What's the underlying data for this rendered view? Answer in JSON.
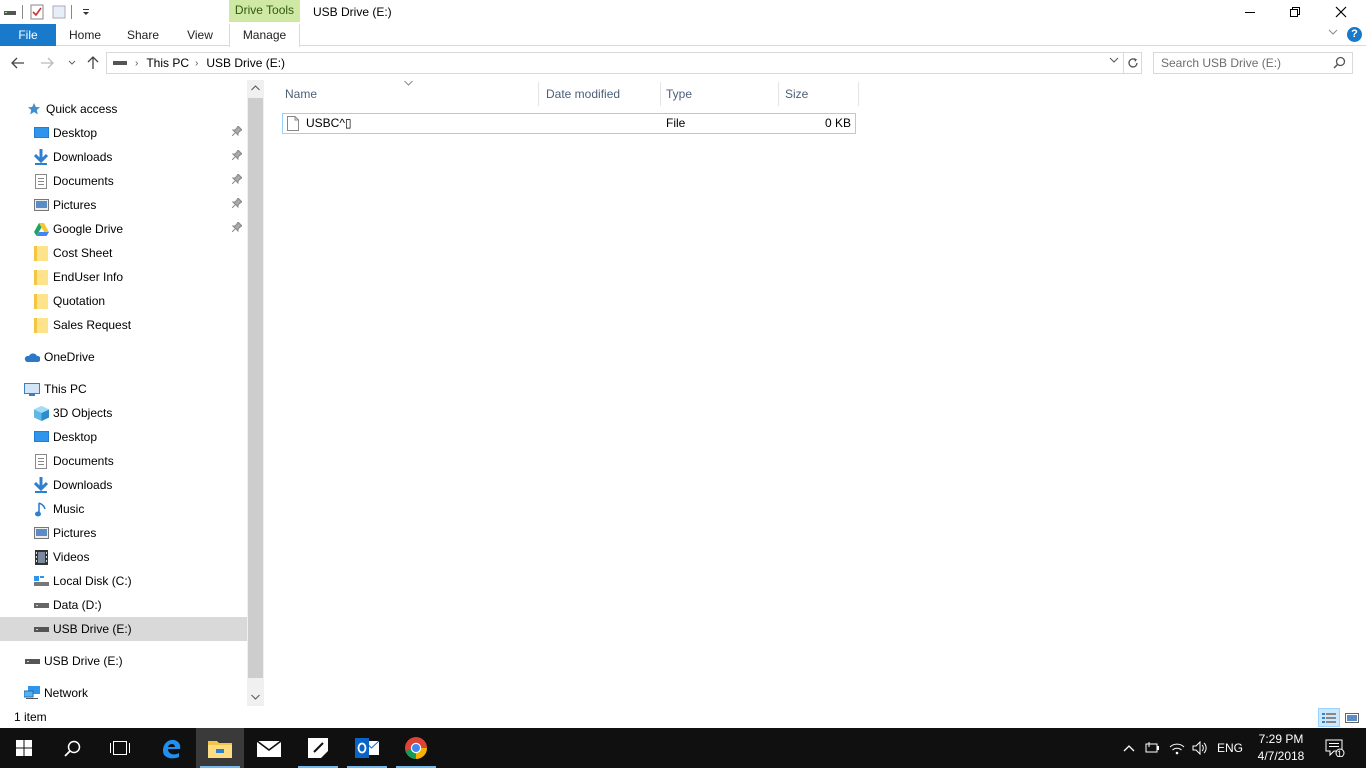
{
  "window": {
    "title": "USB Drive (E:)",
    "context_tab_group": "Drive Tools",
    "controls": {
      "minimize": "—",
      "maximize": "❐",
      "close": "✕"
    }
  },
  "ribbon": {
    "tabs": [
      "File",
      "Home",
      "Share",
      "View",
      "Manage"
    ],
    "file_color": "#1979CA",
    "context_color": "#CFE8A4",
    "help": "?"
  },
  "address": {
    "breadcrumb": [
      "This PC",
      "USB Drive (E:)"
    ],
    "search_placeholder": "Search USB Drive (E:)"
  },
  "nav_pane": {
    "quick_access": {
      "label": "Quick access",
      "items": [
        {
          "label": "Desktop",
          "icon": "desktop-icon",
          "pinned": true
        },
        {
          "label": "Downloads",
          "icon": "downloads-icon",
          "pinned": true
        },
        {
          "label": "Documents",
          "icon": "documents-icon",
          "pinned": true
        },
        {
          "label": "Pictures",
          "icon": "pictures-icon",
          "pinned": true
        },
        {
          "label": "Google Drive",
          "icon": "google-drive-icon",
          "pinned": true
        },
        {
          "label": "Cost Sheet",
          "icon": "folder-icon",
          "pinned": false
        },
        {
          "label": "EndUser Info",
          "icon": "folder-icon",
          "pinned": false
        },
        {
          "label": "Quotation",
          "icon": "folder-icon",
          "pinned": false
        },
        {
          "label": "Sales Request",
          "icon": "folder-icon",
          "pinned": false
        }
      ]
    },
    "onedrive": "OneDrive",
    "this_pc": {
      "label": "This PC",
      "items": [
        {
          "label": "3D Objects",
          "icon": "3d-objects-icon"
        },
        {
          "label": "Desktop",
          "icon": "desktop-icon"
        },
        {
          "label": "Documents",
          "icon": "documents-icon"
        },
        {
          "label": "Downloads",
          "icon": "downloads-icon"
        },
        {
          "label": "Music",
          "icon": "music-icon"
        },
        {
          "label": "Pictures",
          "icon": "pictures-icon"
        },
        {
          "label": "Videos",
          "icon": "videos-icon"
        },
        {
          "label": "Local Disk (C:)",
          "icon": "local-disk-icon"
        },
        {
          "label": "Data (D:)",
          "icon": "drive-icon"
        },
        {
          "label": "USB Drive (E:)",
          "icon": "usb-drive-icon",
          "selected": true
        }
      ]
    },
    "usb_root": "USB Drive (E:)",
    "network": "Network"
  },
  "file_list": {
    "columns": [
      "Name",
      "Date modified",
      "Type",
      "Size"
    ],
    "rows": [
      {
        "name": "USBC^▯",
        "date_modified": "",
        "type": "File",
        "size": "0 KB"
      }
    ]
  },
  "status": {
    "item_count": "1 item"
  },
  "taskbar": {
    "pinned": [
      "start-icon",
      "search-icon",
      "task-view-icon",
      "edge-icon",
      "file-explorer-icon",
      "mail-icon",
      "sticky-notes-icon",
      "outlook-icon",
      "chrome-icon"
    ],
    "language": "ENG",
    "time": "7:29 PM",
    "date": "4/7/2018",
    "notification_count": "1"
  }
}
